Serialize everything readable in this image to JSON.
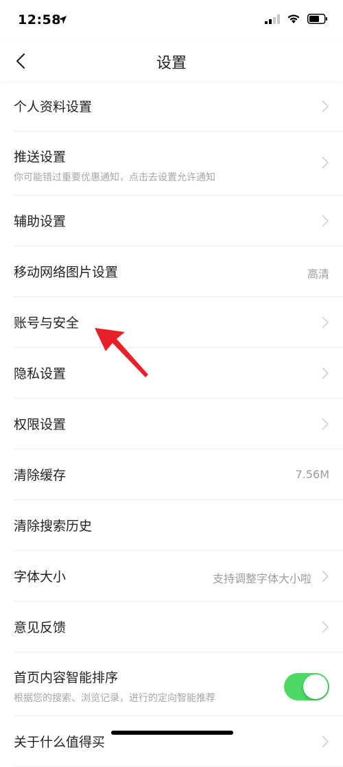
{
  "status_bar": {
    "time": "12:58"
  },
  "nav": {
    "title": "设置"
  },
  "settings": [
    {
      "label": "个人资料设置"
    },
    {
      "label": "推送设置",
      "sub": "你可能错过重要优惠通知，点击去设置允许通知"
    },
    {
      "label": "辅助设置"
    },
    {
      "label": "移动网络图片设置",
      "value": "高清"
    },
    {
      "label": "账号与安全"
    },
    {
      "label": "隐私设置"
    },
    {
      "label": "权限设置"
    },
    {
      "label": "清除缓存",
      "value": "7.56M"
    },
    {
      "label": "清除搜索历史"
    },
    {
      "label": "字体大小",
      "value": "支持调整字体大小啦"
    },
    {
      "label": "意见反馈"
    },
    {
      "label": "首页内容智能排序",
      "sub": "根据您的搜索、浏览记录，进行的定向智能推荐",
      "toggle_on": true
    },
    {
      "label": "关于什么值得买"
    }
  ],
  "icons": {
    "back": "chevron-left-icon",
    "row": "chevron-right-icon",
    "annotation": "red-arrow-icon",
    "location": "location-arrow-icon",
    "signal": "signal-icon",
    "wifi": "wifi-icon",
    "battery": "battery-icon"
  },
  "colors": {
    "toggle_on": "#4cd964",
    "annotation_arrow": "#e8202a",
    "divider": "#ececec",
    "secondary_text": "#9b9b9b"
  }
}
